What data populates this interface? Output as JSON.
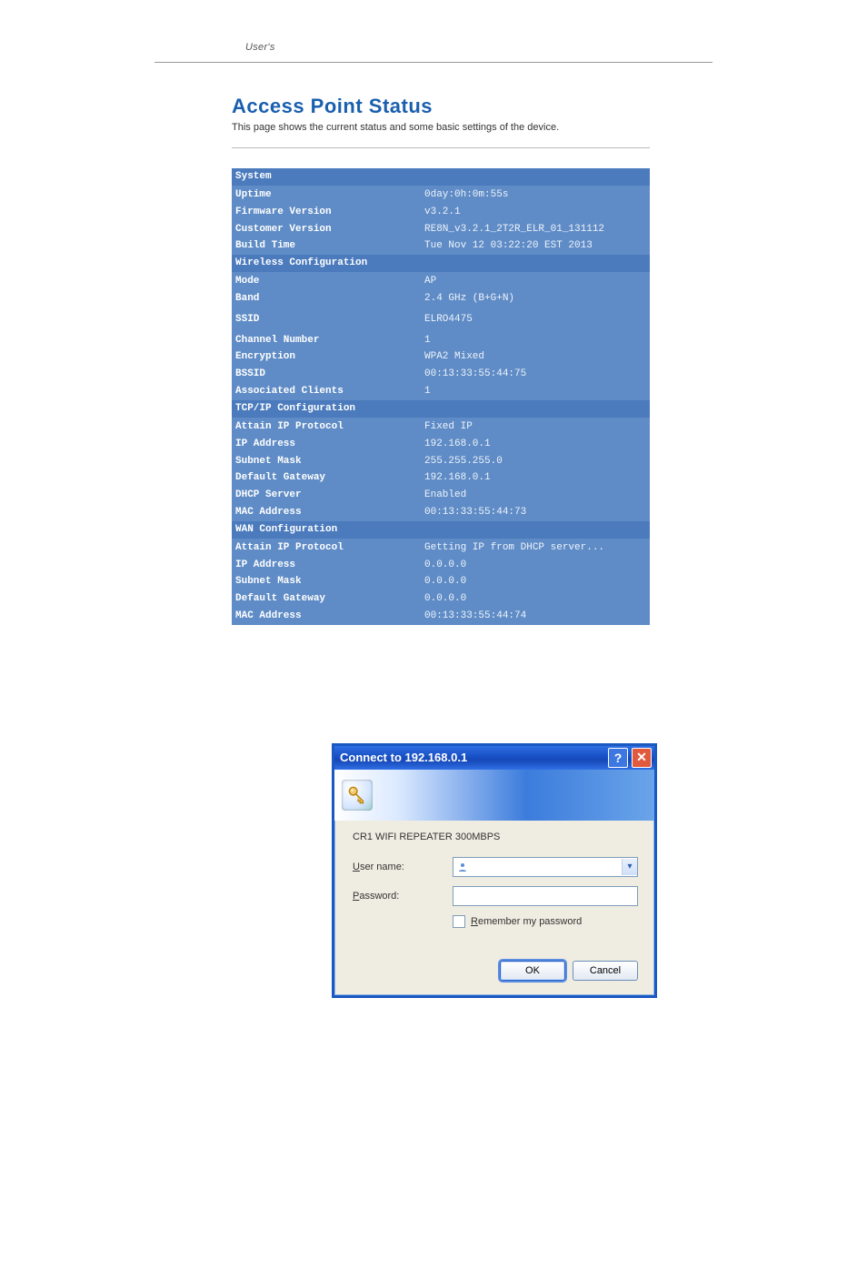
{
  "header": {
    "text": "User's"
  },
  "page_title": "Access Point Status",
  "page_subtitle": "This page shows the current status and some basic settings of the device.",
  "sections": {
    "system": {
      "header": "System",
      "rows": [
        {
          "label": "Uptime",
          "value": "0day:0h:0m:55s"
        },
        {
          "label": "Firmware Version",
          "value": "v3.2.1"
        },
        {
          "label": "Customer Version",
          "value": "RE8N_v3.2.1_2T2R_ELR_01_131112"
        },
        {
          "label": "Build Time",
          "value": "Tue Nov 12 03:22:20 EST 2013"
        }
      ]
    },
    "wireless": {
      "header": "Wireless Configuration",
      "rows": [
        {
          "label": "Mode",
          "value": "AP"
        },
        {
          "label": "Band",
          "value": "2.4 GHz (B+G+N)"
        },
        {
          "label": "SSID",
          "value": "ELRO4475",
          "tall": true
        },
        {
          "label": "Channel Number",
          "value": "1"
        },
        {
          "label": "Encryption",
          "value": "WPA2 Mixed"
        },
        {
          "label": "BSSID",
          "value": "00:13:33:55:44:75"
        },
        {
          "label": "Associated Clients",
          "value": "1"
        }
      ]
    },
    "tcpip": {
      "header": "TCP/IP Configuration",
      "rows": [
        {
          "label": "Attain IP Protocol",
          "value": "Fixed IP"
        },
        {
          "label": "IP Address",
          "value": "192.168.0.1"
        },
        {
          "label": "Subnet Mask",
          "value": "255.255.255.0"
        },
        {
          "label": "Default Gateway",
          "value": "192.168.0.1"
        },
        {
          "label": "DHCP Server",
          "value": "Enabled"
        },
        {
          "label": "MAC Address",
          "value": "00:13:33:55:44:73"
        }
      ]
    },
    "wan": {
      "header": "WAN Configuration",
      "rows": [
        {
          "label": "Attain IP Protocol",
          "value": "Getting IP from DHCP server..."
        },
        {
          "label": "IP Address",
          "value": "0.0.0.0"
        },
        {
          "label": "Subnet Mask",
          "value": "0.0.0.0"
        },
        {
          "label": "Default Gateway",
          "value": "0.0.0.0"
        },
        {
          "label": "MAC Address",
          "value": "00:13:33:55:44:74"
        }
      ]
    }
  },
  "dialog": {
    "title": "Connect to 192.168.0.1",
    "server": "CR1 WIFI REPEATER 300MBPS",
    "username_label_prefix": "U",
    "username_label_rest": "ser name:",
    "password_label_prefix": "P",
    "password_label_rest": "assword:",
    "username_value": "",
    "password_value": "",
    "remember_prefix": "R",
    "remember_rest": "emember my password",
    "ok": "OK",
    "cancel": "Cancel"
  }
}
